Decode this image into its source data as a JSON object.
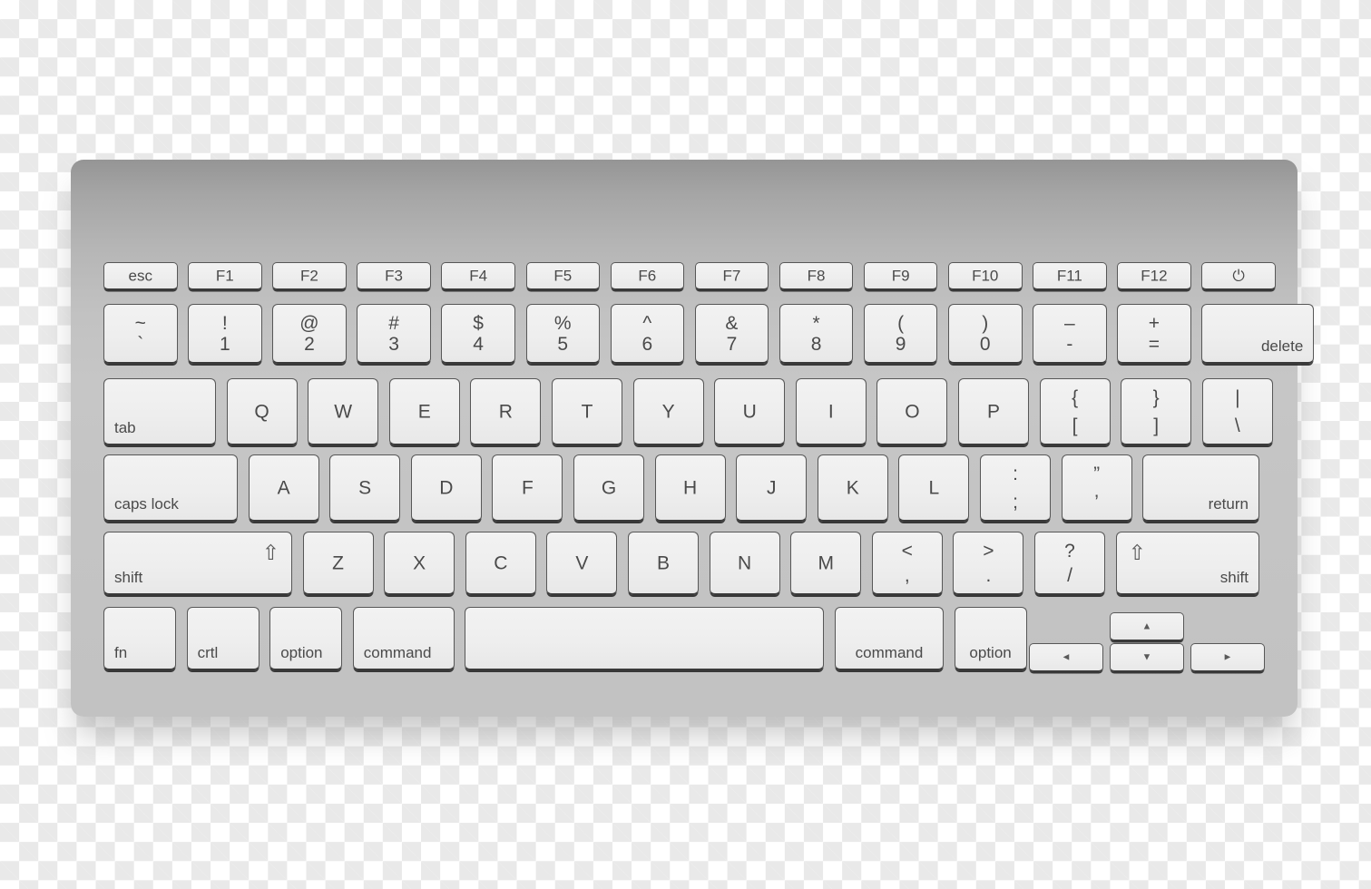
{
  "illustration": {
    "subject": "computer-keyboard",
    "background": "transparency-checkerboard",
    "body_color_top": "#959595",
    "body_color_bottom": "#c2c2c2",
    "key_face_color": "#efefef",
    "key_border_color": "#575757",
    "label_color": "#4a4a4a"
  },
  "rows": {
    "function_row": [
      {
        "name": "esc",
        "label": "esc"
      },
      {
        "name": "f1",
        "label": "F1"
      },
      {
        "name": "f2",
        "label": "F2"
      },
      {
        "name": "f3",
        "label": "F3"
      },
      {
        "name": "f4",
        "label": "F4"
      },
      {
        "name": "f5",
        "label": "F5"
      },
      {
        "name": "f6",
        "label": "F6"
      },
      {
        "name": "f7",
        "label": "F7"
      },
      {
        "name": "f8",
        "label": "F8"
      },
      {
        "name": "f9",
        "label": "F9"
      },
      {
        "name": "f10",
        "label": "F10"
      },
      {
        "name": "f11",
        "label": "F11"
      },
      {
        "name": "f12",
        "label": "F12"
      },
      {
        "name": "power",
        "label": "⏻"
      }
    ],
    "number_row": [
      {
        "name": "backtick",
        "upper": "~",
        "lower": "`"
      },
      {
        "name": "one",
        "upper": "!",
        "lower": "1"
      },
      {
        "name": "two",
        "upper": "@",
        "lower": "2"
      },
      {
        "name": "three",
        "upper": "#",
        "lower": "3"
      },
      {
        "name": "four",
        "upper": "$",
        "lower": "4"
      },
      {
        "name": "five",
        "upper": "%",
        "lower": "5"
      },
      {
        "name": "six",
        "upper": "^",
        "lower": "6"
      },
      {
        "name": "seven",
        "upper": "&",
        "lower": "7"
      },
      {
        "name": "eight",
        "upper": "*",
        "lower": "8"
      },
      {
        "name": "nine",
        "upper": "(",
        "lower": "9"
      },
      {
        "name": "zero",
        "upper": ")",
        "lower": "0"
      },
      {
        "name": "minus",
        "upper": "–",
        "lower": "-"
      },
      {
        "name": "equal",
        "upper": "+",
        "lower": "="
      }
    ],
    "number_row_delete": {
      "name": "delete",
      "label": "delete"
    },
    "tab_row": {
      "tab": {
        "name": "tab",
        "label": "tab"
      },
      "letters": [
        {
          "name": "q",
          "label": "Q"
        },
        {
          "name": "w",
          "label": "W"
        },
        {
          "name": "e",
          "label": "E"
        },
        {
          "name": "r",
          "label": "R"
        },
        {
          "name": "t",
          "label": "T"
        },
        {
          "name": "y",
          "label": "Y"
        },
        {
          "name": "u",
          "label": "U"
        },
        {
          "name": "i",
          "label": "I"
        },
        {
          "name": "o",
          "label": "O"
        },
        {
          "name": "p",
          "label": "P"
        }
      ],
      "brackets": [
        {
          "name": "left-bracket",
          "upper": "{",
          "lower": "["
        },
        {
          "name": "right-bracket",
          "upper": "}",
          "lower": "]"
        },
        {
          "name": "backslash",
          "upper": "|",
          "lower": "\\"
        }
      ]
    },
    "home_row": {
      "caps_lock": {
        "name": "caps-lock",
        "label": "caps lock"
      },
      "letters": [
        {
          "name": "a",
          "label": "A"
        },
        {
          "name": "s",
          "label": "S"
        },
        {
          "name": "d",
          "label": "D"
        },
        {
          "name": "f",
          "label": "F"
        },
        {
          "name": "g",
          "label": "G"
        },
        {
          "name": "h",
          "label": "H"
        },
        {
          "name": "j",
          "label": "J"
        },
        {
          "name": "k",
          "label": "K"
        },
        {
          "name": "l",
          "label": "L"
        }
      ],
      "punctuation": [
        {
          "name": "semicolon",
          "upper": ":",
          "lower": ";"
        },
        {
          "name": "quote",
          "upper": "”",
          "lower": "’"
        }
      ],
      "return": {
        "name": "return",
        "label": "return"
      }
    },
    "shift_row": {
      "left_shift": {
        "name": "left-shift",
        "label": "shift",
        "glyph": "⇧"
      },
      "letters": [
        {
          "name": "z",
          "label": "Z"
        },
        {
          "name": "x",
          "label": "X"
        },
        {
          "name": "c",
          "label": "C"
        },
        {
          "name": "v",
          "label": "V"
        },
        {
          "name": "b",
          "label": "B"
        },
        {
          "name": "n",
          "label": "N"
        },
        {
          "name": "m",
          "label": "M"
        }
      ],
      "punctuation": [
        {
          "name": "comma",
          "upper": "<",
          "lower": ","
        },
        {
          "name": "period",
          "upper": ">",
          "lower": "."
        },
        {
          "name": "slash",
          "upper": "?",
          "lower": "/"
        }
      ],
      "right_shift": {
        "name": "right-shift",
        "label": "shift",
        "glyph": "⇧"
      }
    },
    "bottom_row": {
      "left": [
        {
          "name": "fn",
          "label": "fn"
        },
        {
          "name": "control",
          "label": "crtl"
        },
        {
          "name": "left-option",
          "label": "option"
        },
        {
          "name": "left-command",
          "label": "command"
        }
      ],
      "space": {
        "name": "space-bar",
        "label": ""
      },
      "right": [
        {
          "name": "right-command",
          "label": "command"
        },
        {
          "name": "right-option",
          "label": "option"
        }
      ],
      "arrows": [
        {
          "name": "arrow-up",
          "glyph": "▲"
        },
        {
          "name": "arrow-left",
          "glyph": "◄"
        },
        {
          "name": "arrow-down",
          "glyph": "▼"
        },
        {
          "name": "arrow-right",
          "glyph": "►"
        }
      ]
    }
  }
}
